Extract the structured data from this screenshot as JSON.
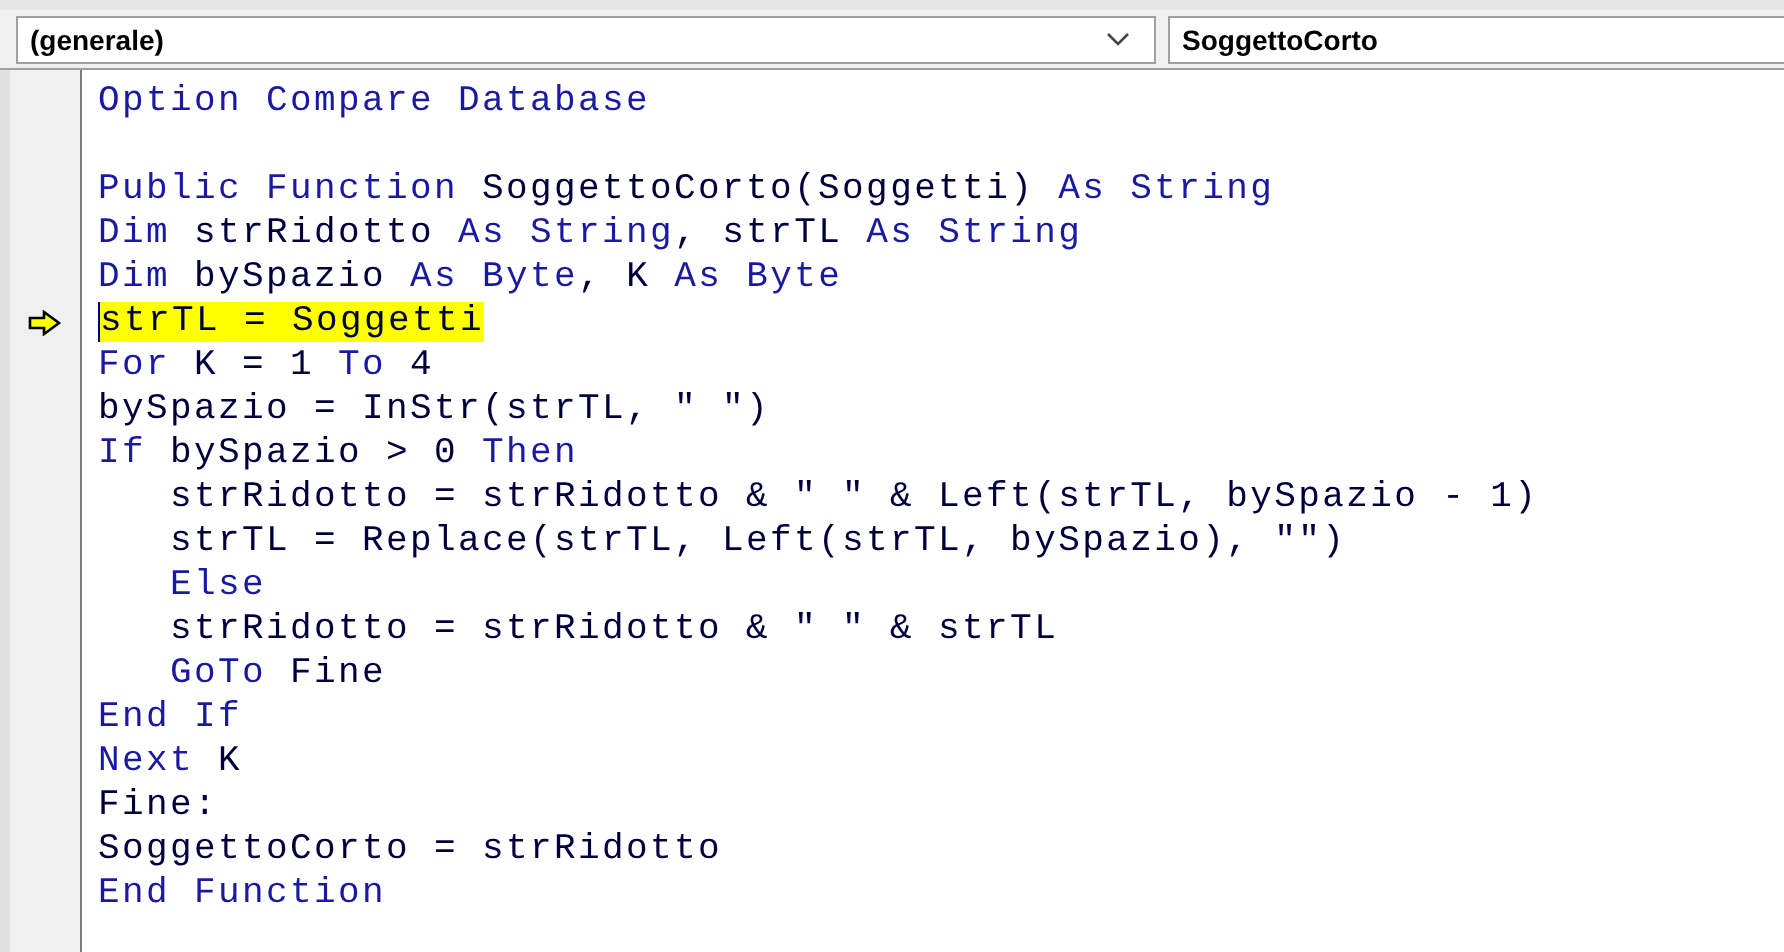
{
  "object_combo": {
    "value": "(generale)"
  },
  "procedure_combo": {
    "value": "SoggettoCorto"
  },
  "code_lines": [
    {
      "current": false,
      "segments": [
        {
          "kind": "keyword",
          "text": "Option Compare Database"
        }
      ]
    },
    {
      "current": false
    },
    {
      "current": false,
      "segments": [
        {
          "kind": "keyword",
          "text": "Public Function"
        },
        {
          "kind": "plain",
          "text": " SoggettoCorto(Soggetti) "
        },
        {
          "kind": "keyword",
          "text": "As String"
        }
      ]
    },
    {
      "current": false,
      "segments": [
        {
          "kind": "keyword",
          "text": "Dim"
        },
        {
          "kind": "plain",
          "text": " strRidotto "
        },
        {
          "kind": "keyword",
          "text": "As String"
        },
        {
          "kind": "plain",
          "text": ", strTL "
        },
        {
          "kind": "keyword",
          "text": "As String"
        }
      ]
    },
    {
      "current": false,
      "segments": [
        {
          "kind": "keyword",
          "text": "Dim"
        },
        {
          "kind": "plain",
          "text": " bySpazio "
        },
        {
          "kind": "keyword",
          "text": "As Byte"
        },
        {
          "kind": "plain",
          "text": ", K "
        },
        {
          "kind": "keyword",
          "text": "As Byte"
        }
      ]
    },
    {
      "current": true,
      "segments": [
        {
          "kind": "plain",
          "text": "strTL = Soggetti"
        }
      ]
    },
    {
      "current": false,
      "segments": [
        {
          "kind": "keyword",
          "text": "For"
        },
        {
          "kind": "plain",
          "text": " K = 1 "
        },
        {
          "kind": "keyword",
          "text": "To"
        },
        {
          "kind": "plain",
          "text": " 4"
        }
      ]
    },
    {
      "current": false,
      "segments": [
        {
          "kind": "plain",
          "text": "bySpazio = InStr(strTL, \" \")"
        }
      ]
    },
    {
      "current": false,
      "segments": [
        {
          "kind": "keyword",
          "text": "If"
        },
        {
          "kind": "plain",
          "text": " bySpazio > 0 "
        },
        {
          "kind": "keyword",
          "text": "Then"
        }
      ],
      "children": [
        {
          "current": false,
          "segments": [
            {
              "kind": "plain",
              "text": "strRidotto = strRidotto & \" \" & Left(strTL, bySpazio - 1)"
            }
          ]
        },
        {
          "current": false,
          "segments": [
            {
              "kind": "plain",
              "text": "strTL = Replace(strTL, Left(strTL, bySpazio), \"\")"
            }
          ]
        },
        {
          "current": false,
          "segments": [
            {
              "kind": "keyword",
              "text": "Else"
            }
          ]
        },
        {
          "current": false,
          "segments": [
            {
              "kind": "plain",
              "text": "strRidotto = strRidotto & \" \" & strTL"
            }
          ]
        },
        {
          "current": false,
          "segments": [
            {
              "kind": "keyword",
              "text": "GoTo"
            },
            {
              "kind": "plain",
              "text": " Fine"
            }
          ]
        }
      ]
    },
    {
      "current": false,
      "segments": [
        {
          "kind": "keyword",
          "text": "End If"
        }
      ]
    },
    {
      "current": false,
      "segments": [
        {
          "kind": "keyword",
          "text": "Next"
        },
        {
          "kind": "plain",
          "text": " K"
        }
      ]
    },
    {
      "current": false,
      "segments": [
        {
          "kind": "plain",
          "text": "Fine:"
        }
      ]
    },
    {
      "current": false,
      "segments": [
        {
          "kind": "plain",
          "text": "SoggettoCorto = strRidotto"
        }
      ]
    },
    {
      "current": false,
      "segments": [
        {
          "kind": "keyword",
          "text": "End Function"
        }
      ]
    }
  ]
}
